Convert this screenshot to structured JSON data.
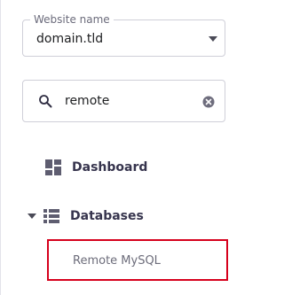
{
  "website_selector": {
    "legend": "Website name",
    "value": "domain.tld",
    "icon": "chevron-down-icon"
  },
  "search": {
    "value": "remote",
    "icons": [
      "search-icon",
      "clear-icon"
    ]
  },
  "nav": {
    "dashboard": {
      "label": "Dashboard",
      "icon": "dashboard-grid-icon"
    },
    "databases": {
      "label": "Databases",
      "icon": "database-list-icon",
      "expanded": true,
      "children": [
        {
          "label": "Remote MySQL",
          "highlighted": true
        }
      ]
    }
  },
  "colors": {
    "highlight_border": "#d6001c",
    "text_primary": "#36344d",
    "icon": "#5e5d70"
  }
}
